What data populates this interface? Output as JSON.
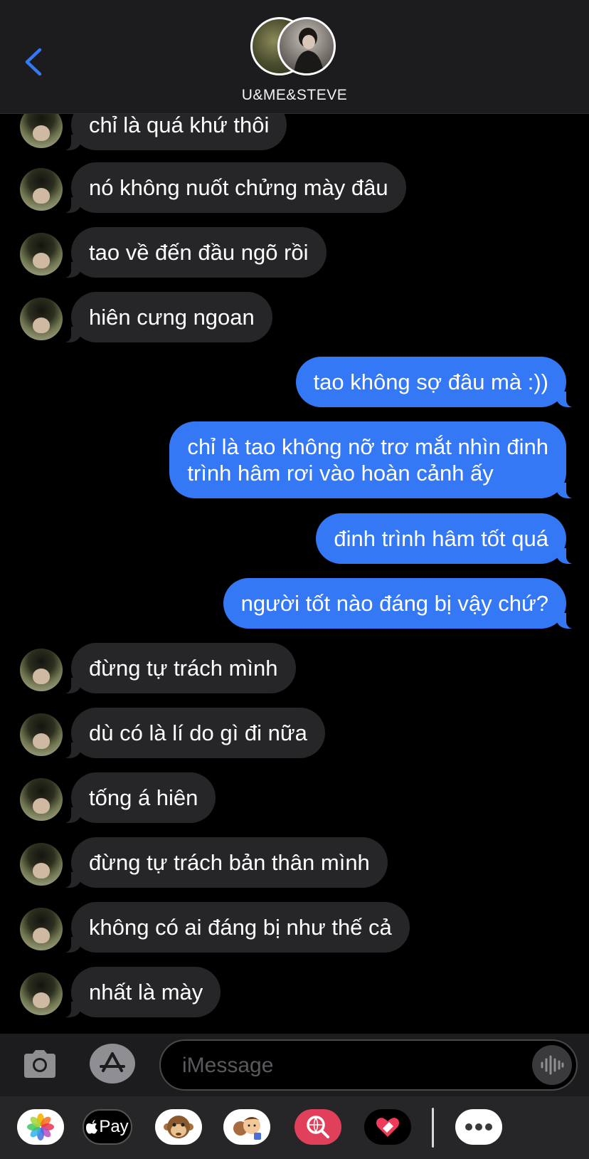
{
  "header": {
    "group_name": "U&ME&STEVE"
  },
  "messages": [
    {
      "dir": "in",
      "text": "chỉ là quá khứ thôi"
    },
    {
      "dir": "in",
      "text": "nó không nuốt chửng mày đâu"
    },
    {
      "dir": "in",
      "text": "tao về đến đầu ngõ rồi"
    },
    {
      "dir": "in",
      "text": "hiên cưng ngoan"
    },
    {
      "dir": "out",
      "text": "tao không sợ đâu mà :))"
    },
    {
      "dir": "out",
      "text": "chỉ là tao không nỡ trơ mắt nhìn đinh",
      "text2": "trình hâm rơi vào hoàn cảnh ấy"
    },
    {
      "dir": "out",
      "text": "đinh trình hâm tốt quá"
    },
    {
      "dir": "out",
      "text": "người tốt nào đáng bị vậy chứ?"
    },
    {
      "dir": "in",
      "text": "đừng tự trách mình"
    },
    {
      "dir": "in",
      "text": "dù có là lí do gì đi nữa"
    },
    {
      "dir": "in",
      "text": "tống á hiên"
    },
    {
      "dir": "in",
      "text": "đừng tự trách bản thân mình"
    },
    {
      "dir": "in",
      "text": "không có ai đáng bị như thế cả"
    },
    {
      "dir": "in",
      "text": "nhất là mày"
    }
  ],
  "input": {
    "placeholder": "iMessage"
  },
  "app_drawer": {
    "apple_pay_label": "Pay",
    "icons": [
      "photos-icon",
      "apple-pay-icon",
      "monkey-memoji-icon",
      "memoji-stickers-icon",
      "web-search-icon",
      "digital-touch-icon",
      "more-icon"
    ]
  },
  "colors": {
    "outgoing_bubble": "#3478f6",
    "incoming_bubble": "#262629",
    "header_bg": "#1c1c1e",
    "accent": "#3478f6"
  }
}
